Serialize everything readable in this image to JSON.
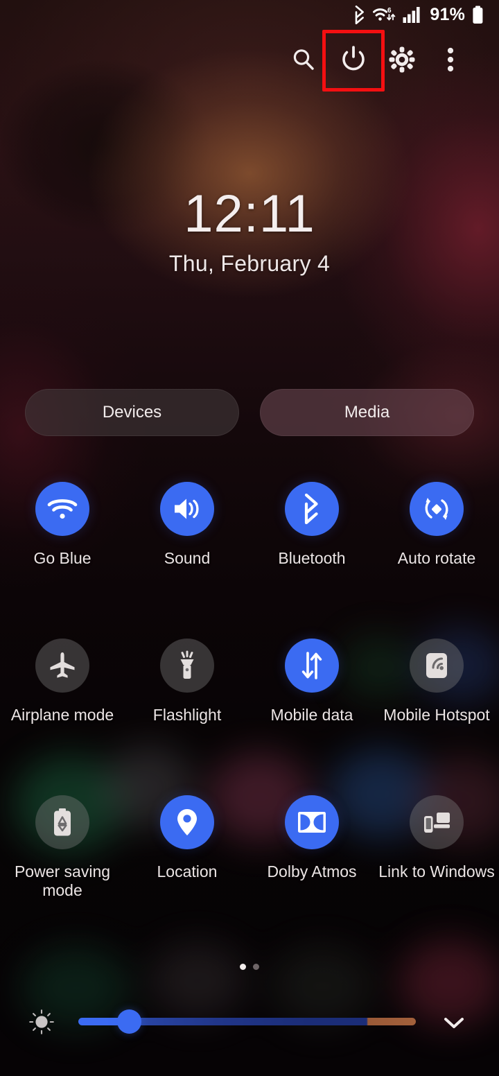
{
  "status_bar": {
    "bluetooth_icon": "bluetooth-icon",
    "wifi_icon": "wifi-6-icon",
    "wifi_generation": "6",
    "signal_icon": "cellular-signal-icon",
    "battery_percent": "91%",
    "battery_icon": "battery-full-icon"
  },
  "action_bar": {
    "search_label": "search-icon",
    "power_label": "power-icon",
    "settings_label": "gear-icon",
    "more_label": "more-options-icon",
    "highlight_color": "#f40f11",
    "highlighted_item": "power-icon"
  },
  "lockscreen": {
    "time": "12:11",
    "date": "Thu, February 4"
  },
  "pills": [
    {
      "label": "Devices",
      "name": "devices-pill",
      "bg": "#403739"
    },
    {
      "label": "Media",
      "name": "media-pill",
      "bg": "#68464f"
    }
  ],
  "accent_on_color": "#3b6bf2",
  "accent_off_color": "#787678",
  "toggles": [
    {
      "label": "Go Blue",
      "icon": "wifi-icon",
      "state": "on"
    },
    {
      "label": "Sound",
      "icon": "volume-icon",
      "state": "on"
    },
    {
      "label": "Bluetooth",
      "icon": "bluetooth-icon",
      "state": "on"
    },
    {
      "label": "Auto rotate",
      "icon": "auto-rotate-icon",
      "state": "on"
    },
    {
      "label": "Airplane mode",
      "icon": "airplane-icon",
      "state": "off"
    },
    {
      "label": "Flashlight",
      "icon": "flashlight-icon",
      "state": "off"
    },
    {
      "label": "Mobile data",
      "icon": "mobile-data-icon",
      "state": "on"
    },
    {
      "label": "Mobile Hotspot",
      "icon": "hotspot-icon",
      "state": "off"
    },
    {
      "label": "Power saving mode",
      "icon": "battery-saver-icon",
      "state": "off"
    },
    {
      "label": "Location",
      "icon": "location-pin-icon",
      "state": "on"
    },
    {
      "label": "Dolby Atmos",
      "icon": "dolby-icon",
      "state": "on"
    },
    {
      "label": "Link to Windows",
      "icon": "link-to-windows-icon",
      "state": "off"
    }
  ],
  "pager": {
    "total": 2,
    "active_index": 0
  },
  "brightness": {
    "sun_icon": "brightness-sun-icon",
    "value_percent": "15",
    "expand_icon": "chevron-down-icon"
  }
}
